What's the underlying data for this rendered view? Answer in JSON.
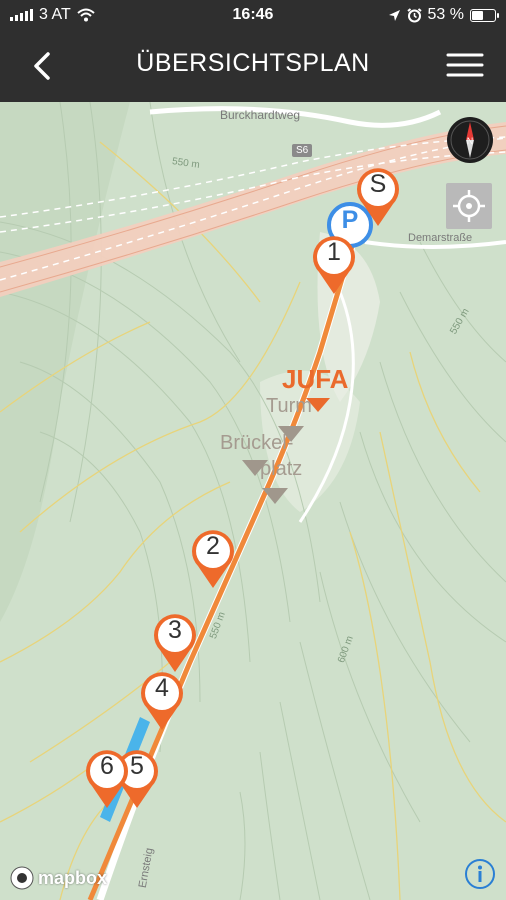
{
  "status_bar": {
    "carrier": "3 AT",
    "time": "16:46",
    "battery_percent": "53 %",
    "battery_level": 0.53
  },
  "nav_bar": {
    "title": "ÜBERSICHTSPLAN",
    "back_icon": "chevron-left-icon",
    "menu_icon": "hamburger-menu-icon"
  },
  "map": {
    "labels": {
      "street_top": "Burckhardtweg",
      "road_badge": "S6",
      "street_right": "Demarstraße",
      "contour_550_a": "550 m",
      "contour_550_b": "550 m",
      "contour_550_c": "550 m",
      "contour_600": "600 m",
      "street_bottom": "Ernsteig"
    },
    "pois": {
      "jufa": "JUFA",
      "turm": "Turm",
      "spielplatz_a": "Brückel-",
      "spielplatz_b": "platz"
    },
    "markers": [
      {
        "label": "S"
      },
      {
        "label": "P"
      },
      {
        "label": "1"
      },
      {
        "label": "2"
      },
      {
        "label": "3"
      },
      {
        "label": "4"
      },
      {
        "label": "5"
      },
      {
        "label": "6"
      }
    ],
    "attribution": "mapbox",
    "colors": {
      "route": "#f0893a",
      "marker": "#ee6a2b",
      "parking": "#3d8ee6",
      "terrain": "#cfe0cb"
    }
  }
}
